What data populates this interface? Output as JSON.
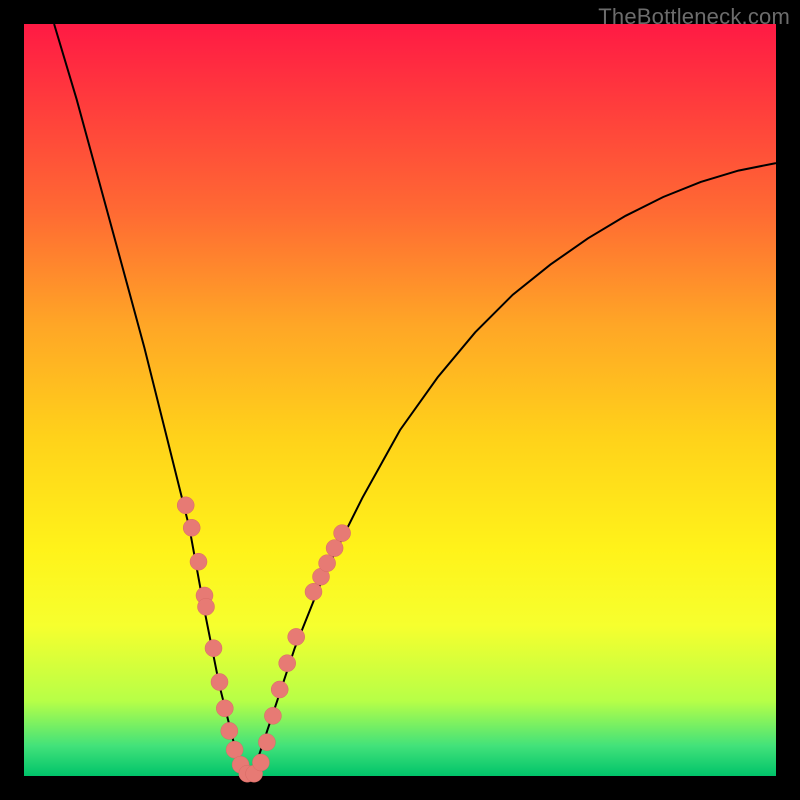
{
  "watermark": "TheBottleneck.com",
  "colors": {
    "frame_bg_top": "#ff1a44",
    "frame_bg_bottom": "#00c36a",
    "curve": "#000000",
    "dot_fill": "#e77a74",
    "page_bg": "#000000"
  },
  "chart_data": {
    "type": "line",
    "title": "",
    "xlabel": "",
    "ylabel": "",
    "xlim": [
      0,
      100
    ],
    "ylim": [
      0,
      100
    ],
    "grid": false,
    "note": "Axes unlabeled; values are percentages of plot width/height estimated from pixels. Higher y = closer to top (more bottleneck).",
    "series": [
      {
        "name": "bottleneck-curve",
        "x": [
          4,
          7,
          10,
          13,
          16,
          19,
          22,
          24,
          26,
          28,
          29.5,
          31,
          33,
          36,
          40,
          45,
          50,
          55,
          60,
          65,
          70,
          75,
          80,
          85,
          90,
          95,
          100
        ],
        "y": [
          100,
          90,
          79,
          68,
          57,
          45,
          33,
          22,
          12,
          4,
          0,
          2,
          8,
          17,
          27,
          37,
          46,
          53,
          59,
          64,
          68,
          71.5,
          74.5,
          77,
          79,
          80.5,
          81.5
        ]
      }
    ],
    "marked_points": {
      "name": "highlighted-dots",
      "points": [
        {
          "x": 21.5,
          "y": 36
        },
        {
          "x": 22.3,
          "y": 33
        },
        {
          "x": 23.2,
          "y": 28.5
        },
        {
          "x": 24.0,
          "y": 24
        },
        {
          "x": 24.2,
          "y": 22.5
        },
        {
          "x": 25.2,
          "y": 17
        },
        {
          "x": 26.0,
          "y": 12.5
        },
        {
          "x": 26.7,
          "y": 9
        },
        {
          "x": 27.3,
          "y": 6
        },
        {
          "x": 28.0,
          "y": 3.5
        },
        {
          "x": 28.8,
          "y": 1.5
        },
        {
          "x": 29.7,
          "y": 0.3
        },
        {
          "x": 30.6,
          "y": 0.3
        },
        {
          "x": 31.5,
          "y": 1.8
        },
        {
          "x": 32.3,
          "y": 4.5
        },
        {
          "x": 33.1,
          "y": 8
        },
        {
          "x": 34.0,
          "y": 11.5
        },
        {
          "x": 35.0,
          "y": 15
        },
        {
          "x": 36.2,
          "y": 18.5
        },
        {
          "x": 38.5,
          "y": 24.5
        },
        {
          "x": 39.5,
          "y": 26.5
        },
        {
          "x": 40.3,
          "y": 28.3
        },
        {
          "x": 41.3,
          "y": 30.3
        },
        {
          "x": 42.3,
          "y": 32.3
        }
      ]
    }
  }
}
